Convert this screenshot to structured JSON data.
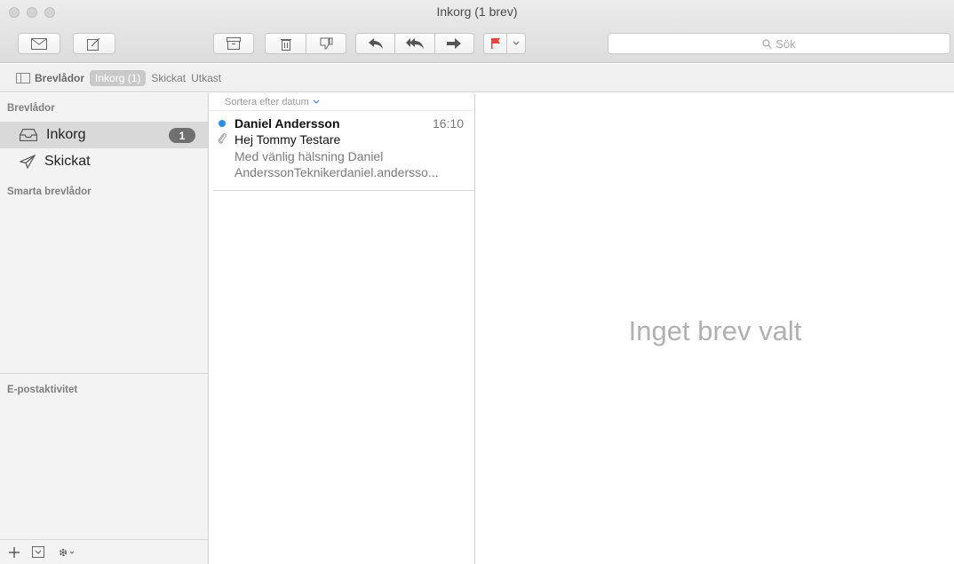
{
  "window": {
    "title": "Inkorg (1 brev)"
  },
  "toolbar": {
    "search_placeholder": "Sök",
    "buttons": [
      "get-mail",
      "compose",
      "archive",
      "delete",
      "junk",
      "reply",
      "reply-all",
      "forward",
      "flag",
      "flag-menu"
    ],
    "flag_color": "#e8463f"
  },
  "favorites_bar": {
    "mailboxes_label": "Brevlådor",
    "inbox_label": "Inkorg (1)",
    "sent_label": "Skickat",
    "drafts_label": "Utkast"
  },
  "sidebar": {
    "mailboxes_heading": "Brevlådor",
    "items": [
      {
        "label": "Inkorg",
        "badge": "1",
        "icon": "inbox-tray-icon",
        "selected": true
      },
      {
        "label": "Skickat",
        "icon": "paper-plane-icon",
        "selected": false
      }
    ],
    "smart_heading": "Smarta brevlådor",
    "activity_heading": "E-postaktivitet"
  },
  "message_list": {
    "sort_label": "Sortera efter datum",
    "messages": [
      {
        "sender": "Daniel Andersson",
        "time": "16:10",
        "subject": "Hej Tommy Testare",
        "preview_line1": "Med vänlig hälsning Daniel",
        "preview_line2": "AnderssonTeknikerdaniel.andersso...",
        "unread": true,
        "has_attachment": true,
        "unread_color": "#2a8ee8"
      }
    ]
  },
  "reading_pane": {
    "empty_text": "Inget brev valt"
  }
}
